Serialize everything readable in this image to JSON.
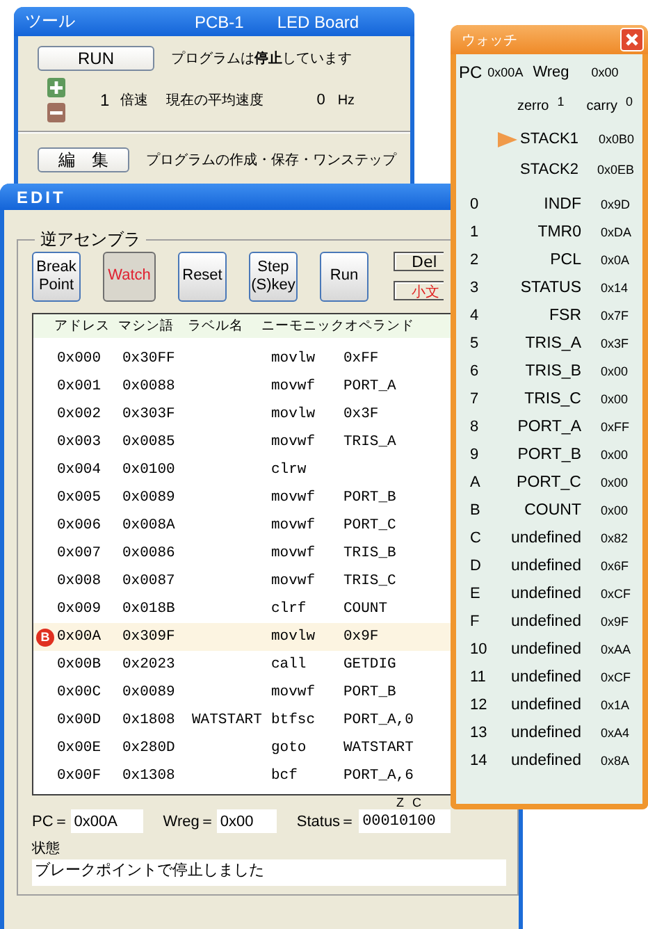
{
  "tool_window": {
    "title": "ツール",
    "board_id": "PCB-1",
    "board_name": "LED Board",
    "run_button": "RUN",
    "run_status": "プログラムは**停止**しています",
    "speed_value": "1",
    "speed_unit": "倍速",
    "average_label": "現在の平均速度",
    "average_value": "0",
    "average_unit": "Hz",
    "edit_button": "編　集",
    "edit_description": "プログラムの作成・保存・ワンステップ"
  },
  "edit_window": {
    "title": "EDIT",
    "group_label": "逆アセンブラ",
    "buttons": [
      {
        "lines": [
          "Break",
          "Point"
        ],
        "pressed": false
      },
      {
        "lines": [
          "Watch"
        ],
        "pressed": true
      },
      {
        "lines": [
          "Reset"
        ],
        "pressed": false
      },
      {
        "lines": [
          "Step",
          "(S)key"
        ],
        "pressed": false
      },
      {
        "lines": [
          "Run"
        ],
        "pressed": false
      }
    ],
    "side_buttons": [
      {
        "label": "Del",
        "kind": "plain"
      },
      {
        "label": "小文",
        "kind": "alert"
      }
    ],
    "table": {
      "columns": [
        "アドレス",
        "マシン語",
        "ラベル名",
        "ニーモニック",
        "オペランド"
      ],
      "breakpoint_badge": "B",
      "rows": [
        {
          "address": "0x000",
          "code": "0x30FF",
          "label": "",
          "mnemonic": "movlw",
          "operand": "0xFF",
          "breakpoint": false,
          "selected": false
        },
        {
          "address": "0x001",
          "code": "0x0088",
          "label": "",
          "mnemonic": "movwf",
          "operand": "PORT_A",
          "breakpoint": false,
          "selected": false
        },
        {
          "address": "0x002",
          "code": "0x303F",
          "label": "",
          "mnemonic": "movlw",
          "operand": "0x3F",
          "breakpoint": false,
          "selected": false
        },
        {
          "address": "0x003",
          "code": "0x0085",
          "label": "",
          "mnemonic": "movwf",
          "operand": "TRIS_A",
          "breakpoint": false,
          "selected": false
        },
        {
          "address": "0x004",
          "code": "0x0100",
          "label": "",
          "mnemonic": "clrw",
          "operand": "",
          "breakpoint": false,
          "selected": false
        },
        {
          "address": "0x005",
          "code": "0x0089",
          "label": "",
          "mnemonic": "movwf",
          "operand": "PORT_B",
          "breakpoint": false,
          "selected": false
        },
        {
          "address": "0x006",
          "code": "0x008A",
          "label": "",
          "mnemonic": "movwf",
          "operand": "PORT_C",
          "breakpoint": false,
          "selected": false
        },
        {
          "address": "0x007",
          "code": "0x0086",
          "label": "",
          "mnemonic": "movwf",
          "operand": "TRIS_B",
          "breakpoint": false,
          "selected": false
        },
        {
          "address": "0x008",
          "code": "0x0087",
          "label": "",
          "mnemonic": "movwf",
          "operand": "TRIS_C",
          "breakpoint": false,
          "selected": false
        },
        {
          "address": "0x009",
          "code": "0x018B",
          "label": "",
          "mnemonic": "clrf",
          "operand": "COUNT",
          "breakpoint": false,
          "selected": false
        },
        {
          "address": "0x00A",
          "code": "0x309F",
          "label": "",
          "mnemonic": "movlw",
          "operand": "0x9F",
          "breakpoint": true,
          "selected": true
        },
        {
          "address": "0x00B",
          "code": "0x2023",
          "label": "",
          "mnemonic": "call",
          "operand": "GETDIG",
          "breakpoint": false,
          "selected": false
        },
        {
          "address": "0x00C",
          "code": "0x0089",
          "label": "",
          "mnemonic": "movwf",
          "operand": "PORT_B",
          "breakpoint": false,
          "selected": false
        },
        {
          "address": "0x00D",
          "code": "0x1808",
          "label": "WATSTART",
          "mnemonic": "btfsc",
          "operand": "PORT_A,0",
          "breakpoint": false,
          "selected": false
        },
        {
          "address": "0x00E",
          "code": "0x280D",
          "label": "",
          "mnemonic": "goto",
          "operand": "WATSTART",
          "breakpoint": false,
          "selected": false
        },
        {
          "address": "0x00F",
          "code": "0x1308",
          "label": "",
          "mnemonic": "bcf",
          "operand": "PORT_A,6",
          "breakpoint": false,
          "selected": false
        }
      ]
    },
    "pc_label": "PC＝",
    "pc_value": "0x00A",
    "wreg_label": "Wreg＝",
    "wreg_value": "0x00",
    "status_label": "Status＝",
    "status_value": "00010100",
    "flag_labels": [
      "Z",
      "C"
    ],
    "state_label": "状態",
    "state_message": "ブレークポイントで停止しました"
  },
  "watch_window": {
    "title": "ウォッチ",
    "pc_label": "PC",
    "pc_value": "0x00A",
    "wreg_label": "Wreg",
    "wreg_value": "0x00",
    "zero_label": "zerro",
    "zero_value": "1",
    "carry_label": "carry",
    "carry_value": "0",
    "stack": [
      {
        "name": "STACK1",
        "value": "0x0B0",
        "current": true
      },
      {
        "name": "STACK2",
        "value": "0x0EB",
        "current": false
      }
    ],
    "registers": [
      {
        "index": "0",
        "name": "INDF",
        "value": "0x9D"
      },
      {
        "index": "1",
        "name": "TMR0",
        "value": "0xDA"
      },
      {
        "index": "2",
        "name": "PCL",
        "value": "0x0A"
      },
      {
        "index": "3",
        "name": "STATUS",
        "value": "0x14"
      },
      {
        "index": "4",
        "name": "FSR",
        "value": "0x7F"
      },
      {
        "index": "5",
        "name": "TRIS_A",
        "value": "0x3F"
      },
      {
        "index": "6",
        "name": "TRIS_B",
        "value": "0x00"
      },
      {
        "index": "7",
        "name": "TRIS_C",
        "value": "0x00"
      },
      {
        "index": "8",
        "name": "PORT_A",
        "value": "0xFF"
      },
      {
        "index": "9",
        "name": "PORT_B",
        "value": "0x00"
      },
      {
        "index": "A",
        "name": "PORT_C",
        "value": "0x00"
      },
      {
        "index": "B",
        "name": "COUNT",
        "value": "0x00"
      },
      {
        "index": "C",
        "name": "undefined",
        "value": "0x82"
      },
      {
        "index": "D",
        "name": "undefined",
        "value": "0x6F"
      },
      {
        "index": "E",
        "name": "undefined",
        "value": "0xCF"
      },
      {
        "index": "F",
        "name": "undefined",
        "value": "0x9F"
      },
      {
        "index": "10",
        "name": "undefined",
        "value": "0xAA"
      },
      {
        "index": "11",
        "name": "undefined",
        "value": "0xCF"
      },
      {
        "index": "12",
        "name": "undefined",
        "value": "0x1A"
      },
      {
        "index": "13",
        "name": "undefined",
        "value": "0xA4"
      },
      {
        "index": "14",
        "name": "undefined",
        "value": "0x8A"
      }
    ]
  }
}
